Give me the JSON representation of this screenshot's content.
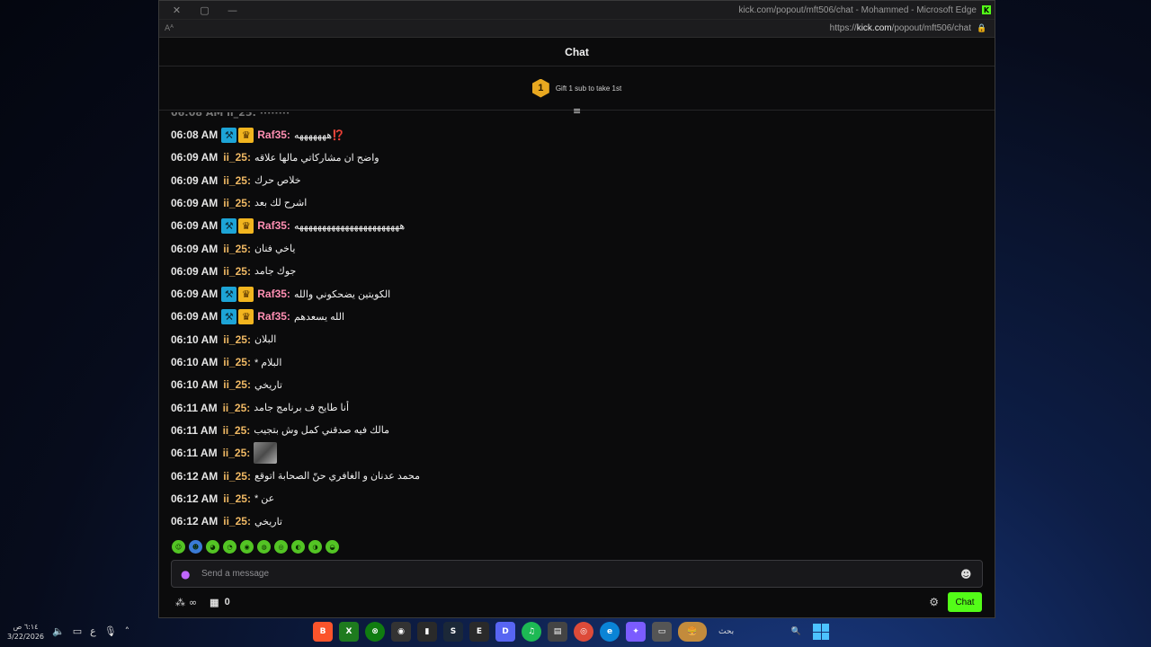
{
  "window": {
    "title": "kick.com/popout/mft506/chat - Mohammed - Microsoft Edge",
    "url_prefix": "https://",
    "url_domain": "kick.com",
    "url_path": "/popout/mft506/chat",
    "read_aloud": "Aᴬ"
  },
  "chat": {
    "header": "Chat",
    "gift_rank": "1",
    "gift_text": "Gift 1 sub to take 1st"
  },
  "colors": {
    "raf_user": "#ff8fb3",
    "ii_user": "#f0b964",
    "accent": "#53fc18"
  },
  "messages": [
    {
      "time": "06:08 AM",
      "user": "Raf35:",
      "text": "⁉️هههههههه",
      "badges": true
    },
    {
      "time": "06:09 AM",
      "user": "ii_25:",
      "text": "واضح ان مشاركاتي مالها علاقه",
      "badges": false
    },
    {
      "time": "06:09 AM",
      "user": "ii_25:",
      "text": "خلاص حرك",
      "badges": false
    },
    {
      "time": "06:09 AM",
      "user": "ii_25:",
      "text": "اشرح لك بعد",
      "badges": false
    },
    {
      "time": "06:09 AM",
      "user": "Raf35:",
      "text": "هههههههههههههههههههههههه",
      "badges": true
    },
    {
      "time": "06:09 AM",
      "user": "ii_25:",
      "text": "ياخي فنان",
      "badges": false
    },
    {
      "time": "06:09 AM",
      "user": "ii_25:",
      "text": "جوك جامد",
      "badges": false
    },
    {
      "time": "06:09 AM",
      "user": "Raf35:",
      "text": "الكويتين يضحكوني والله",
      "badges": true
    },
    {
      "time": "06:09 AM",
      "user": "Raf35:",
      "text": "الله يسعدهم",
      "badges": true
    },
    {
      "time": "06:10 AM",
      "user": "ii_25:",
      "text": "البلان",
      "badges": false
    },
    {
      "time": "06:10 AM",
      "user": "ii_25:",
      "text": "البلام *",
      "badges": false
    },
    {
      "time": "06:10 AM",
      "user": "ii_25:",
      "text": "تاريخي",
      "badges": false
    },
    {
      "time": "06:11 AM",
      "user": "ii_25:",
      "text": "أنا طايح ف برنامج جامد",
      "badges": false
    },
    {
      "time": "06:11 AM",
      "user": "ii_25:",
      "text": "مالك فيه صدقني كمل وش بتجيب",
      "badges": false
    },
    {
      "time": "06:11 AM",
      "user": "ii_25:",
      "text": "",
      "badges": false,
      "image": true
    },
    {
      "time": "06:12 AM",
      "user": "ii_25:",
      "text": "محمد عدنان و الغافري حنّ الصحابة اتوقع",
      "badges": false
    },
    {
      "time": "06:12 AM",
      "user": "ii_25:",
      "text": "عن *",
      "badges": false
    },
    {
      "time": "06:12 AM",
      "user": "ii_25:",
      "text": "تاريخي",
      "badges": false
    }
  ],
  "input": {
    "placeholder": "Send a message"
  },
  "toolbar": {
    "points_value": "∞",
    "store_count": "0",
    "chat_button": "Chat"
  },
  "taskbar": {
    "time": "٦:١٤ ص",
    "date": "3/22/2026",
    "search_label": "بحث",
    "lang": "ع"
  }
}
